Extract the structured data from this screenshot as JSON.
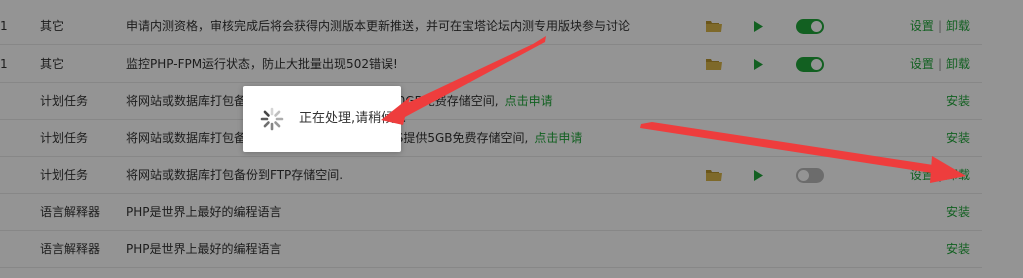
{
  "rows": [
    {
      "idx": "1",
      "type": "其它",
      "desc": "申请内测资格，审核完成后将会获得内测版本更新推送，并可在宝塔论坛内测专用版块参与讨论",
      "link": "",
      "folder": true,
      "play": true,
      "toggle": "on",
      "ops": [
        "设置",
        "卸载"
      ]
    },
    {
      "idx": "1",
      "type": "其它",
      "desc": "监控PHP-FPM运行状态，防止大批量出现502错误!",
      "link": "",
      "folder": true,
      "play": true,
      "toggle": "on",
      "ops": [
        "设置",
        "卸载"
      ]
    },
    {
      "idx": "",
      "type": "计划任务",
      "desc": "将网站或数据库打包备份到七牛云存储，七牛提供10GB免费存储空间,",
      "link": "点击申请",
      "folder": false,
      "play": false,
      "toggle": "",
      "ops": [
        "安装"
      ]
    },
    {
      "idx": "",
      "type": "计划任务",
      "desc": "将网站或数据库打包备份到阿里云OSS，阿里云OSS提供5GB免费存储空间,",
      "link": "点击申请",
      "folder": false,
      "play": false,
      "toggle": "",
      "ops": [
        "安装"
      ]
    },
    {
      "idx": "",
      "type": "计划任务",
      "desc": "将网站或数据库打包备份到FTP存储空间.",
      "link": "",
      "folder": true,
      "play": true,
      "toggle": "off",
      "ops": [
        "设置",
        "卸载"
      ]
    },
    {
      "idx": "",
      "type": "语言解释器",
      "desc": "PHP是世界上最好的编程语言",
      "link": "",
      "folder": false,
      "play": false,
      "toggle": "",
      "ops": [
        "安装"
      ]
    },
    {
      "idx": "",
      "type": "语言解释器",
      "desc": "PHP是世界上最好的编程语言",
      "link": "",
      "folder": false,
      "play": false,
      "toggle": "",
      "ops": [
        "安装"
      ]
    }
  ],
  "separator": "|",
  "loading": {
    "text": "正在处理,请稍候..."
  },
  "icons": {
    "folder": "folder-icon",
    "play": "play-icon",
    "spinner": "spinner-icon"
  },
  "colors": {
    "accent": "#20a53a",
    "toggle_off": "#bbbbbb",
    "arrow": "#ee3d3d",
    "folder": "#d9b649"
  }
}
